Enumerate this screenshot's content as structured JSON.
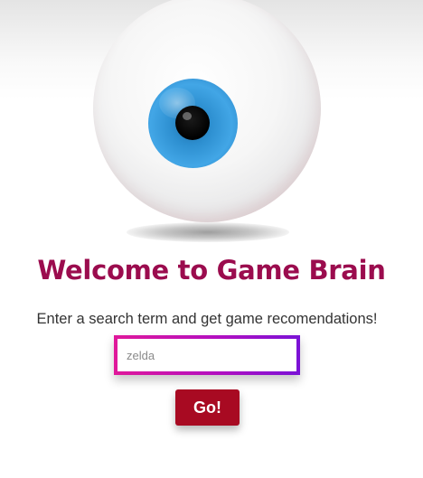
{
  "hero": {
    "logo_icon": "eyeball-icon"
  },
  "heading": {
    "title": "Welcome to Game Brain",
    "subtitle": "Enter a search term and get game recomendations!"
  },
  "search": {
    "placeholder": "zelda",
    "value": ""
  },
  "actions": {
    "go_label": "Go!"
  },
  "colors": {
    "title": "#9b0c4e",
    "button": "#a80a22",
    "input_border_start": "#e0189a",
    "input_border_end": "#7a12d6",
    "iris": "#42a6e6"
  }
}
